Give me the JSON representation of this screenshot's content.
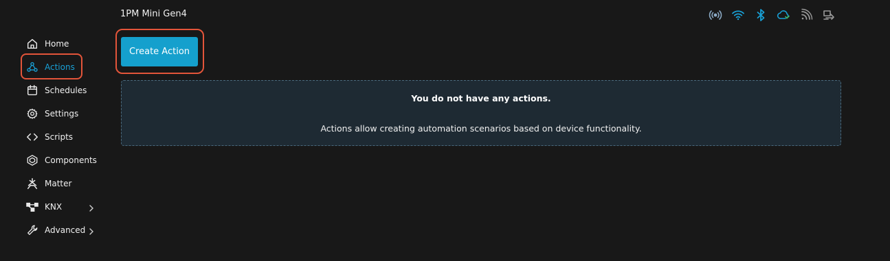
{
  "header": {
    "device_name": "1PM Mini Gen4",
    "status_icons": [
      {
        "name": "signal-broadcast-icon",
        "color": "#8aa9c4"
      },
      {
        "name": "wifi-icon",
        "color": "#18a0d6"
      },
      {
        "name": "bluetooth-icon",
        "color": "#18a0d6"
      },
      {
        "name": "cloud-sync-icon",
        "color": "#18a0d6"
      },
      {
        "name": "rss-icon",
        "color": "#9a9a9a"
      },
      {
        "name": "device-link-icon",
        "color": "#9a9a9a"
      }
    ]
  },
  "sidebar": {
    "items": [
      {
        "label": "Home",
        "icon": "home-icon"
      },
      {
        "label": "Actions",
        "icon": "webhook-icon",
        "active": true
      },
      {
        "label": "Schedules",
        "icon": "calendar-icon"
      },
      {
        "label": "Settings",
        "icon": "gear-icon"
      },
      {
        "label": "Scripts",
        "icon": "code-icon"
      },
      {
        "label": "Components",
        "icon": "components-icon"
      },
      {
        "label": "Matter",
        "icon": "matter-icon"
      },
      {
        "label": "KNX",
        "icon": "knx-icon",
        "has_submenu": true
      },
      {
        "label": "Advanced",
        "icon": "wrench-icon",
        "has_submenu": true
      }
    ]
  },
  "main": {
    "create_button_label": "Create Action",
    "empty_state": {
      "title": "You do not have any actions.",
      "description": "Actions allow creating automation scenarios based on device functionality."
    }
  },
  "colors": {
    "background": "#181818",
    "accent": "#15a0cd",
    "active_nav": "#18a0d6",
    "highlight": "#e4553a",
    "panel": "#1e2a33"
  }
}
